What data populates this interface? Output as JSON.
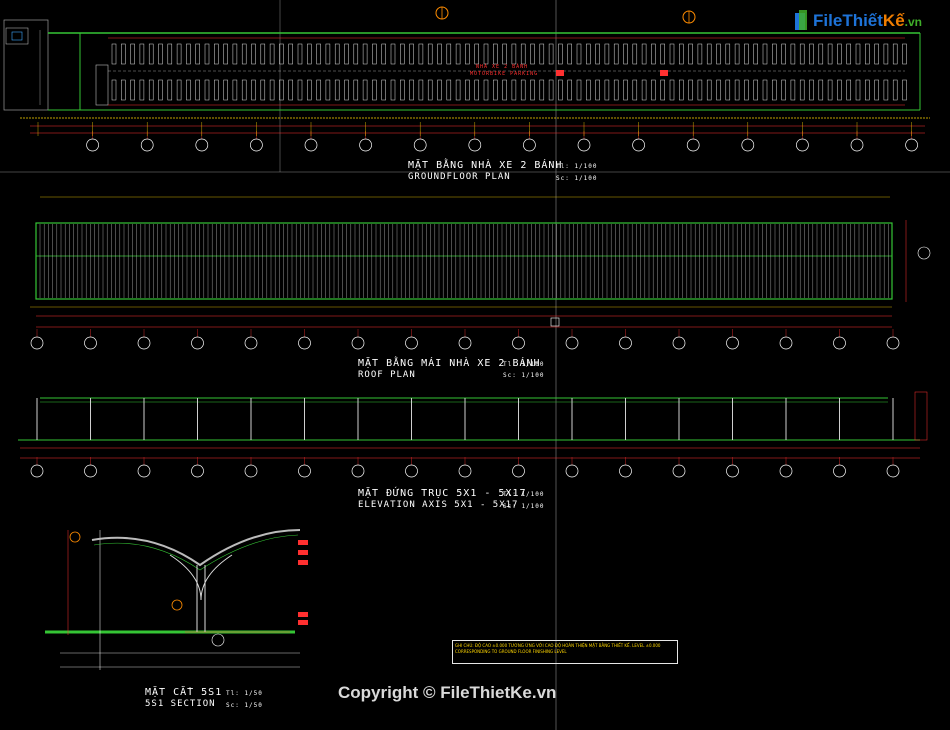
{
  "drawing": {
    "brand": {
      "logo_file": "File",
      "logo_thiet": "Thiết",
      "logo_ke": "Kế",
      "logo_vn": ".vn",
      "colors": {
        "blue": "#1e73d8",
        "green": "#3fae29",
        "orange": "#ef7d00"
      }
    },
    "copyright": "Copyright © FileThietKe.vn",
    "ground_plan": {
      "title_vi": "MẶT BẰNG NHÀ XE 2 BÁNH",
      "title_en": "GROUNDFLOOR PLAN",
      "scale_1": "Tl: 1/100",
      "scale_2": "Sc: 1/100",
      "center_label_1": "NHÀ XE 2 BÁNH",
      "center_label_2": "MOTORBIKE PARKING"
    },
    "roof_plan": {
      "title_vi": "MẶT BẰNG MÁI NHÀ XE 2 BÁNH",
      "title_en": "ROOF PLAN",
      "scale_1": "Tl: 1/100",
      "scale_2": "Sc: 1/100"
    },
    "elevation": {
      "title_vi": "MẶT ĐỨNG TRỤC 5X1 - 5X17",
      "title_en": "ELEVATION AXIS 5X1 - 5X17",
      "scale_1": "Tl: 1/100",
      "scale_2": "Sc: 1/100"
    },
    "section": {
      "title_vi": "MẶT CẮT 5S1",
      "title_en": "5S1 SECTION",
      "scale_1": "Tl: 1/50",
      "scale_2": "Sc: 1/50"
    },
    "note_text": "GHI CHÚ: ĐỘ CAO ±0.000 TƯƠNG ỨNG VỚI CAO ĐỘ HOÀN THIỆN MẶT BẰNG THIẾT KẾ. LEVEL ±0.000 CORRESPONDING TO GROUND FLOOR FINISHING LEVEL"
  }
}
